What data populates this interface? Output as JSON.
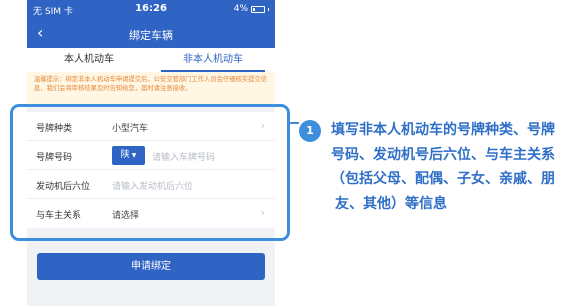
{
  "status_bar": {
    "carrier": "无 SIM 卡",
    "time": "16:26",
    "battery": "4%"
  },
  "nav": {
    "title": "绑定车辆",
    "back_icon": "chevron-left-icon"
  },
  "tabs": [
    {
      "label": "本人机动车",
      "active": false
    },
    {
      "label": "非本人机动车",
      "active": true
    }
  ],
  "notice": "温馨提示：绑定非本人机动车申请提交后，公安交管部门工作人员会仔细核实提交信息，我们会将审核结果及时告知给您，届时请注意接收。",
  "form": {
    "plate_type": {
      "label": "号牌种类",
      "value": "小型汽车"
    },
    "plate_number": {
      "label": "号牌号码",
      "province": "陕",
      "placeholder": "请输入车牌号码"
    },
    "engine_number": {
      "label": "发动机后六位",
      "placeholder": "请输入发动机后六位"
    },
    "relation": {
      "label": "与车主关系",
      "value": "请选择"
    }
  },
  "submit_label": "申请绑定",
  "annotation": {
    "step": "1",
    "line1": "填写非本人机动车的号牌种类、号牌",
    "line2": "号码、发动机号后六位、与车主关系",
    "line3": "（包括父母、配偶、子女、亲戚、朋",
    "line4": "友、其他）等信息",
    "accent_color": "#3d8fde"
  }
}
